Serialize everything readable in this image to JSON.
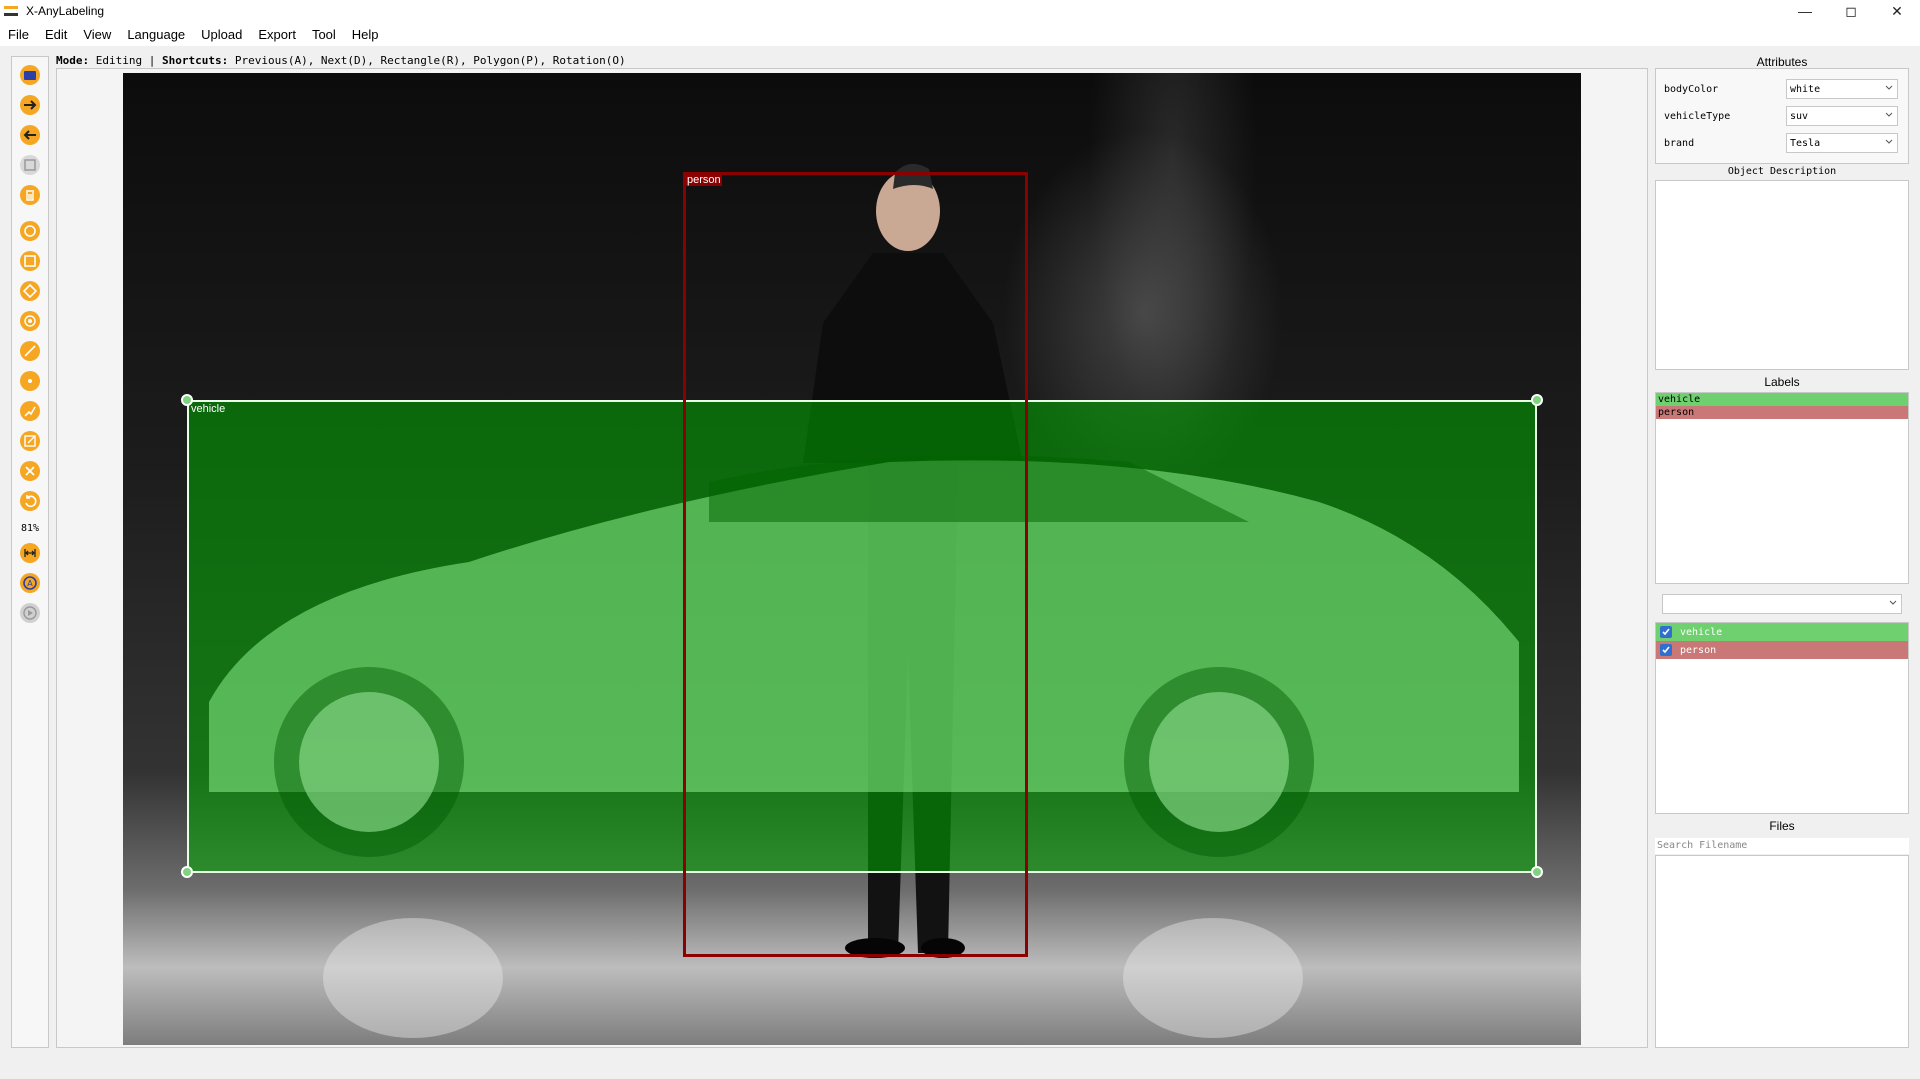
{
  "window": {
    "title": "X-AnyLabeling",
    "controls": [
      "—",
      "◻",
      "✕"
    ]
  },
  "menu": [
    "File",
    "Edit",
    "View",
    "Language",
    "Upload",
    "Export",
    "Tool",
    "Help"
  ],
  "toolbar": {
    "zoom": "81%",
    "tools": [
      {
        "icon": "open-folder-icon",
        "color": "#f5a623"
      },
      {
        "icon": "next-image-icon",
        "color": "#f5a623"
      },
      {
        "icon": "prev-image-icon",
        "color": "#f5a623"
      },
      {
        "icon": "save-icon",
        "color": "#c9c9c9"
      },
      {
        "icon": "delete-file-icon",
        "color": "#f5a623"
      },
      {
        "icon": "polygon-icon",
        "color": "#f5a623"
      },
      {
        "icon": "rectangle-icon",
        "color": "#f5a623"
      },
      {
        "icon": "rotation-icon",
        "color": "#f5a623"
      },
      {
        "icon": "circle-icon",
        "color": "#f5a623"
      },
      {
        "icon": "line-icon",
        "color": "#f5a623"
      },
      {
        "icon": "point-icon",
        "color": "#f5a623"
      },
      {
        "icon": "linestrip-icon",
        "color": "#f5a623"
      },
      {
        "icon": "edit-icon",
        "color": "#f5a623"
      },
      {
        "icon": "delete-shape-icon",
        "color": "#f5a623"
      },
      {
        "icon": "undo-icon",
        "color": "#f5a623"
      },
      {
        "icon": "fit-width-icon",
        "color": "#f5a623"
      },
      {
        "icon": "auto-label-icon",
        "color": "#f5a623"
      },
      {
        "icon": "run-icon",
        "color": "#c9c9c9"
      }
    ]
  },
  "mode_line": {
    "mode_label": "Mode:",
    "mode_value": " Editing | ",
    "shortcuts_label": "Shortcuts:",
    "shortcuts_value": " Previous(A), Next(D), Rectangle(R), Polygon(P), Rotation(O)"
  },
  "canvas": {
    "annotations": [
      {
        "label": "vehicle",
        "color": "#00aa00"
      },
      {
        "label": "person",
        "color": "#8b0000"
      }
    ]
  },
  "attributes": {
    "title": "Attributes",
    "rows": [
      {
        "key": "bodyColor",
        "value": "white"
      },
      {
        "key": "vehicleType",
        "value": "suv"
      },
      {
        "key": "brand",
        "value": "Tesla"
      }
    ],
    "description_title": "Object Description"
  },
  "labels": {
    "title": "Labels",
    "items": [
      {
        "name": "vehicle",
        "color": "#6fd06f"
      },
      {
        "name": "person",
        "color": "#c97777"
      }
    ]
  },
  "shapes": {
    "items": [
      {
        "name": "vehicle",
        "color": "#6fd06f",
        "checked": true
      },
      {
        "name": "person",
        "color": "#c97777",
        "checked": true
      }
    ]
  },
  "files": {
    "title": "Files",
    "search_placeholder": "Search Filename"
  }
}
